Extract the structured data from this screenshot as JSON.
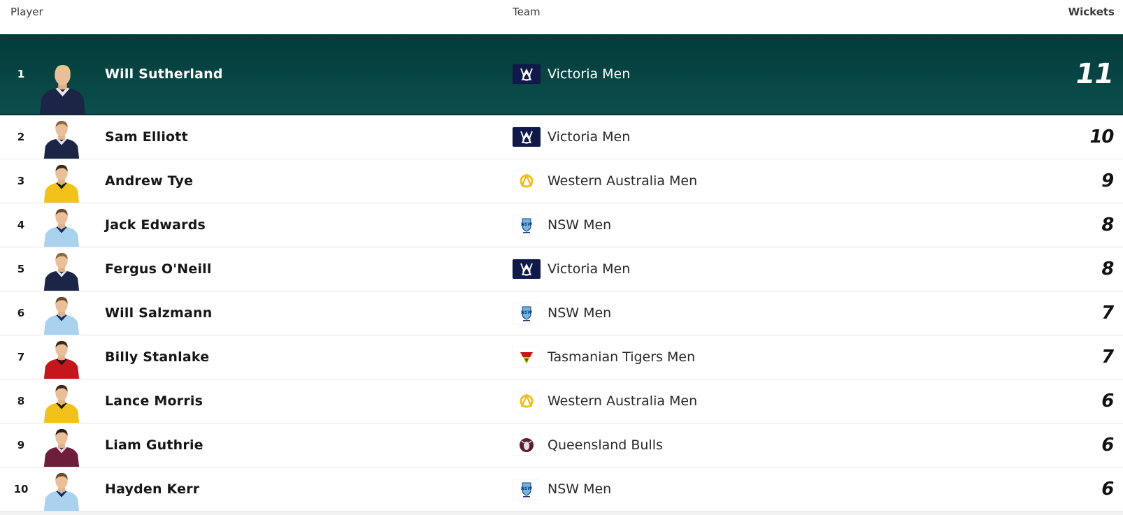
{
  "columns": {
    "player": "Player",
    "team": "Team",
    "wickets": "Wickets"
  },
  "highlight_color": "#044040",
  "rows": [
    {
      "rank": "1",
      "name": "Will Sutherland",
      "team": "Victoria Men",
      "team_icon": "victoria-logo-icon",
      "wickets": "11",
      "kit": "navy"
    },
    {
      "rank": "2",
      "name": "Sam Elliott",
      "team": "Victoria Men",
      "team_icon": "victoria-logo-icon",
      "wickets": "10",
      "kit": "navy"
    },
    {
      "rank": "3",
      "name": "Andrew Tye",
      "team": "Western Australia Men",
      "team_icon": "western-australia-logo-icon",
      "wickets": "9",
      "kit": "yellow"
    },
    {
      "rank": "4",
      "name": "Jack Edwards",
      "team": "NSW Men",
      "team_icon": "nsw-logo-icon",
      "wickets": "8",
      "kit": "sky"
    },
    {
      "rank": "5",
      "name": "Fergus O'Neill",
      "team": "Victoria Men",
      "team_icon": "victoria-logo-icon",
      "wickets": "8",
      "kit": "navy"
    },
    {
      "rank": "6",
      "name": "Will Salzmann",
      "team": "NSW Men",
      "team_icon": "nsw-logo-icon",
      "wickets": "7",
      "kit": "sky"
    },
    {
      "rank": "7",
      "name": "Billy Stanlake",
      "team": "Tasmanian Tigers Men",
      "team_icon": "tasmania-logo-icon",
      "wickets": "7",
      "kit": "red"
    },
    {
      "rank": "8",
      "name": "Lance Morris",
      "team": "Western Australia Men",
      "team_icon": "western-australia-logo-icon",
      "wickets": "6",
      "kit": "yellow"
    },
    {
      "rank": "9",
      "name": "Liam Guthrie",
      "team": "Queensland Bulls",
      "team_icon": "queensland-logo-icon",
      "wickets": "6",
      "kit": "maroon"
    },
    {
      "rank": "10",
      "name": "Hayden Kerr",
      "team": "NSW Men",
      "team_icon": "nsw-logo-icon",
      "wickets": "6",
      "kit": "sky"
    }
  ]
}
